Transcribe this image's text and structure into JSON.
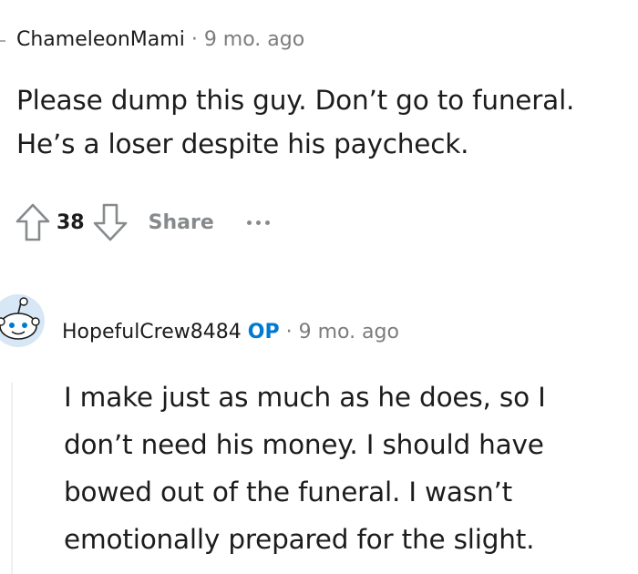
{
  "comments": [
    {
      "username": "ChameleonMami",
      "separator": "·",
      "age": "9 mo. ago",
      "lines": [
        "Please dump this guy. Don’t go to funeral.",
        "He’s a loser despite his paycheck."
      ],
      "score": "38",
      "share_label": "Share"
    },
    {
      "username": "HopefulCrew8484",
      "badge": "OP",
      "separator": "·",
      "age": "9 mo. ago",
      "lines": [
        "I make just as much as he does, so I",
        "don’t need his money. I should have",
        "bowed out of the funeral. I wasn’t",
        "emotionally prepared for the slight."
      ]
    }
  ],
  "colors": {
    "text": "#1c1c1c",
    "muted": "#7c7c7c",
    "icon": "#878a8c",
    "op_badge": "#0079d3",
    "thread_line": "#edeff1",
    "avatar_bg": "#a5cbe8"
  },
  "icons": {
    "upvote": "arrow-up-outline-icon",
    "downvote": "arrow-down-outline-icon",
    "more": "ellipsis-icon",
    "avatar": "reddit-snoo-avatar-icon"
  }
}
